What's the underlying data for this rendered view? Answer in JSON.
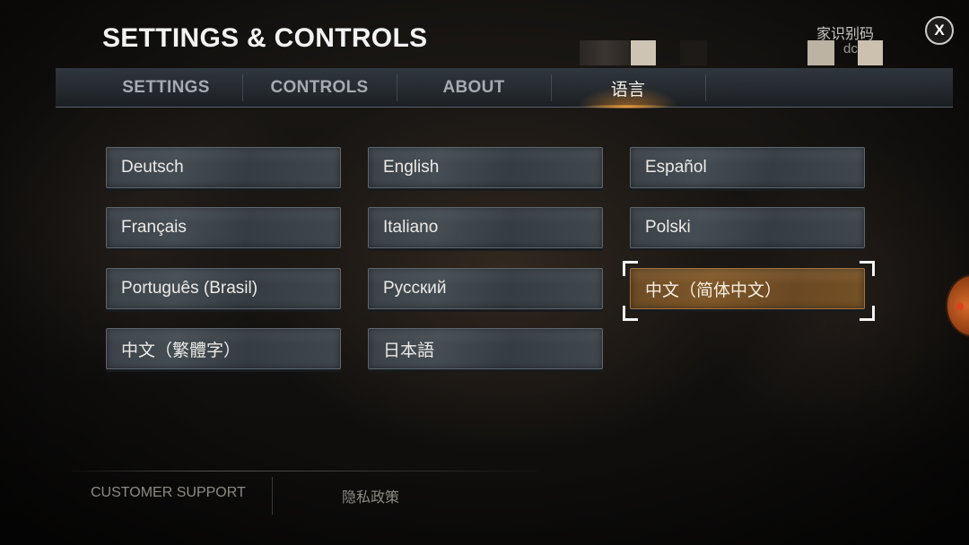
{
  "header": {
    "title": "SETTINGS & CONTROLS",
    "player_id_label": "家识别码",
    "player_id_value": "dc",
    "close_label": "X"
  },
  "tabs": [
    {
      "label": "SETTINGS",
      "active": false
    },
    {
      "label": "CONTROLS",
      "active": false
    },
    {
      "label": "ABOUT",
      "active": false
    },
    {
      "label": "语言",
      "active": true
    }
  ],
  "languages": [
    {
      "label": "Deutsch",
      "selected": false
    },
    {
      "label": "English",
      "selected": false
    },
    {
      "label": "Español",
      "selected": false
    },
    {
      "label": "Français",
      "selected": false
    },
    {
      "label": "Italiano",
      "selected": false
    },
    {
      "label": "Polski",
      "selected": false
    },
    {
      "label": "Português (Brasil)",
      "selected": false
    },
    {
      "label": "Русский",
      "selected": false
    },
    {
      "label": "中文（简体中文）",
      "selected": true
    },
    {
      "label": "中文（繁體字）",
      "selected": false
    },
    {
      "label": "日本語",
      "selected": false
    }
  ],
  "footer": {
    "support_label": "CUSTOMER SUPPORT",
    "privacy_label": "隐私政策"
  },
  "colors": {
    "accent": "#e8962e",
    "selected_button": "#7a5428",
    "button": "#3f474e"
  }
}
